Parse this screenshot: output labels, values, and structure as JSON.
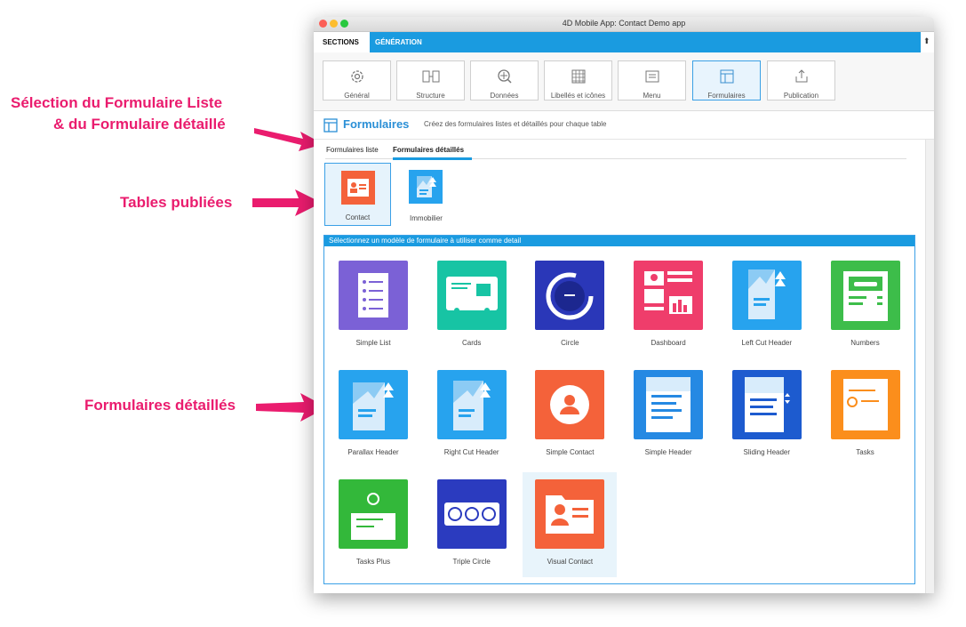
{
  "annotations": {
    "line1": "Sélection du Formulaire Liste",
    "line2": "& du Formulaire détaillé",
    "tables": "Tables publiées",
    "forms": "Formulaires détaillés"
  },
  "window": {
    "title": "4D Mobile App: Contact Demo app"
  },
  "sections": {
    "tab1": "SECTIONS",
    "tab2": "GÉNÉRATION",
    "export_icon": "⬆"
  },
  "toolbar": [
    {
      "label": "Général",
      "icon": "gear-icon"
    },
    {
      "label": "Structure",
      "icon": "structure-icon"
    },
    {
      "label": "Données",
      "icon": "data-icon"
    },
    {
      "label": "Libellés et icônes",
      "icon": "labels-icon"
    },
    {
      "label": "Menu",
      "icon": "menu-icon"
    },
    {
      "label": "Formulaires",
      "icon": "forms-icon"
    },
    {
      "label": "Publication",
      "icon": "publish-icon"
    }
  ],
  "header": {
    "title": "Formulaires",
    "description": "Créez des formulaires listes et détaillés pour chaque table"
  },
  "form_tabs": {
    "list": "Formulaires liste",
    "detail": "Formulaires détaillés"
  },
  "tables": [
    {
      "label": "Contact"
    },
    {
      "label": "Immobilier"
    }
  ],
  "templates_header": "Sélectionnez un modèle de formulaire à utiliser comme detail",
  "templates": [
    {
      "label": "Simple List",
      "color": "#7b61d6"
    },
    {
      "label": "Cards",
      "color": "#17c4a4"
    },
    {
      "label": "Circle",
      "color": "#2a37b8"
    },
    {
      "label": "Dashboard",
      "color": "#ef3d6b"
    },
    {
      "label": "Left Cut Header",
      "color": "#27a3ee"
    },
    {
      "label": "Numbers",
      "color": "#3dbd4a"
    },
    {
      "label": "Parallax Header",
      "color": "#27a3ee"
    },
    {
      "label": "Right Cut Header",
      "color": "#27a3ee"
    },
    {
      "label": "Simple Contact",
      "color": "#f4623a"
    },
    {
      "label": "Simple Header",
      "color": "#2589e3"
    },
    {
      "label": "Sliding Header",
      "color": "#1d5bcf"
    },
    {
      "label": "Tasks",
      "color": "#fb8e1c"
    },
    {
      "label": "Tasks Plus",
      "color": "#33b83a"
    },
    {
      "label": "Triple Circle",
      "color": "#2b3bbf"
    },
    {
      "label": "Visual Contact",
      "color": "#f4623a"
    }
  ]
}
